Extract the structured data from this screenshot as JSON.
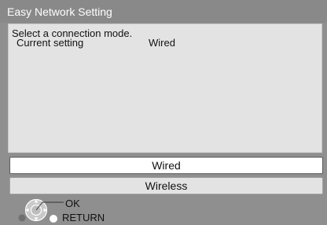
{
  "window": {
    "title": "Easy Network Setting"
  },
  "message": {
    "prompt": "Select a connection mode.",
    "current_label": "Current setting",
    "current_value": "Wired"
  },
  "options": [
    {
      "label": "Wired",
      "selected": true
    },
    {
      "label": "Wireless",
      "selected": false
    }
  ],
  "guide": {
    "ok_label": "OK",
    "return_label": "RETURN",
    "icons": [
      "dpad-icon",
      "ok-button-icon",
      "return-button-icon",
      "dot-icon"
    ]
  },
  "colors": {
    "background": "#8f8f8f",
    "panel": "#e3e3e3",
    "selected": "#ffffff"
  }
}
